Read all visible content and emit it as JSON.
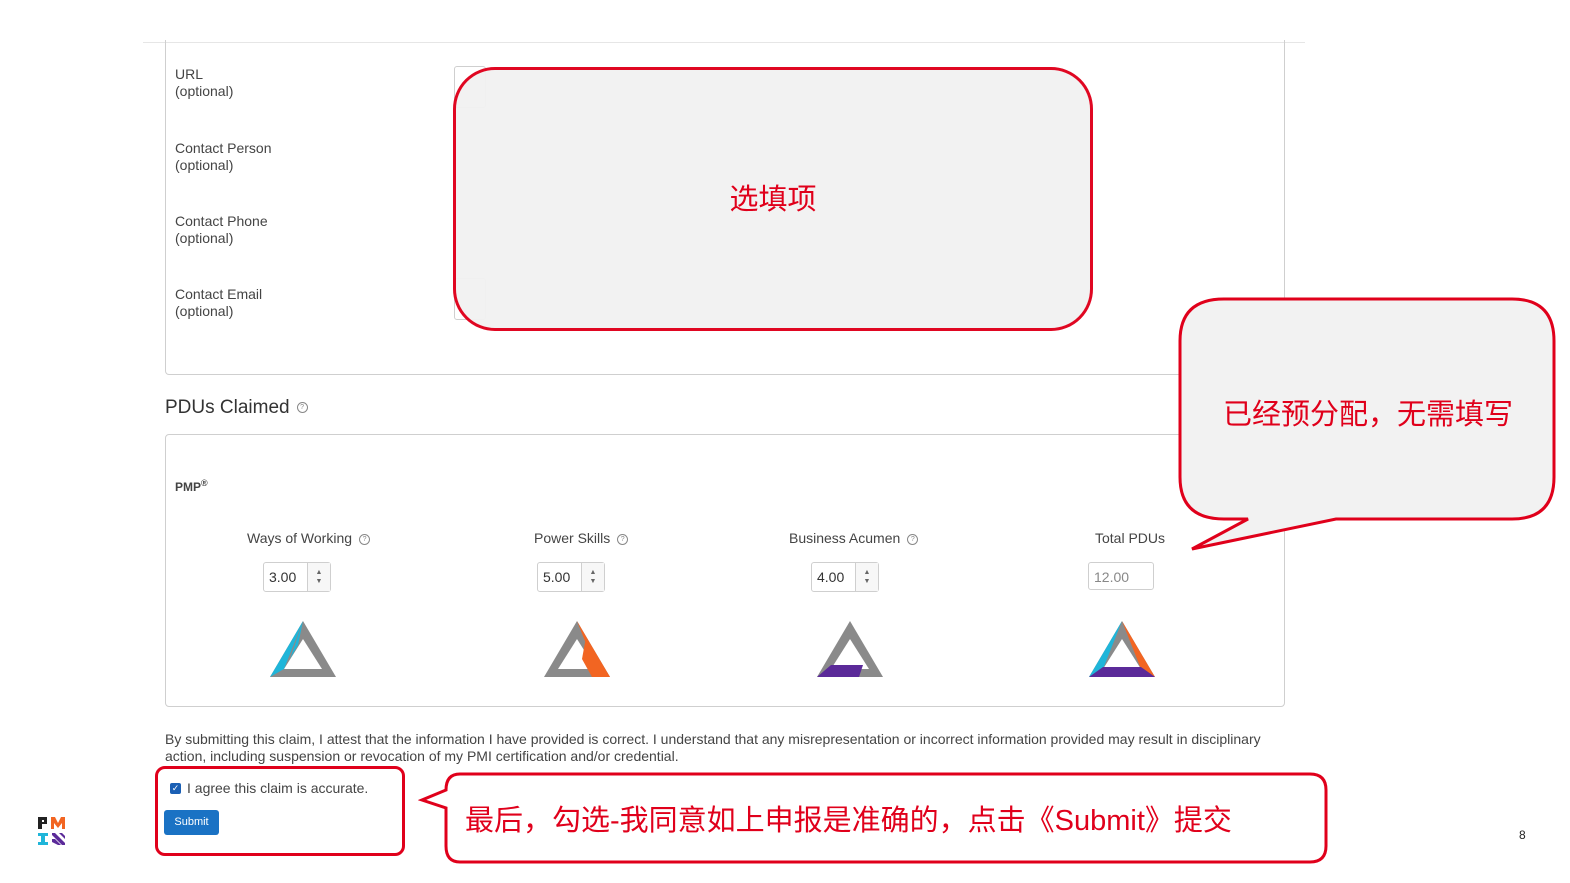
{
  "contact_fields": [
    {
      "label": "URL",
      "sub": "(optional)"
    },
    {
      "label": "Contact Person",
      "sub": "(optional)"
    },
    {
      "label": "Contact Phone",
      "sub": "(optional)"
    },
    {
      "label": "Contact Email",
      "sub": "(optional)"
    }
  ],
  "pdus": {
    "title": "PDUs Claimed",
    "help_icon": "?",
    "certification": "PMP",
    "certification_mark": "®",
    "columns": [
      {
        "label": "Ways of Working",
        "value": "3.00",
        "icon": "ways-of-working-triangle-icon"
      },
      {
        "label": "Power Skills",
        "value": "5.00",
        "icon": "power-skills-triangle-icon"
      },
      {
        "label": "Business Acumen",
        "value": "4.00",
        "icon": "business-acumen-triangle-icon"
      }
    ],
    "total": {
      "label": "Total PDUs",
      "value": "12.00",
      "icon": "talent-triangle-icon"
    },
    "spinner_up": "▲",
    "spinner_down": "▼"
  },
  "disclaimer": "By submitting this claim, I attest that the information I have provided is correct. I understand that any misrepresentation or incorrect information provided may result in disciplinary action, including suspension or revocation of my PMI certification and/or credential.",
  "agree": {
    "label": "I agree this claim is accurate.",
    "checked": true,
    "check_glyph": "✓"
  },
  "submit_label": "Submit",
  "annotations": {
    "optional_fields": "选填项",
    "preassigned": "已经预分配，无需填写",
    "final_step": "最后，勾选-我同意如上申报是准确的，点击《Submit》提交"
  },
  "page_number": "8",
  "colors": {
    "accent_red": "#e0001b",
    "submit_blue": "#1a72c4",
    "ways_of_working": "#1fb5d9",
    "power_skills": "#f26522",
    "business_acumen": "#5b2a99",
    "triangle_gray": "#8a8a8a"
  }
}
